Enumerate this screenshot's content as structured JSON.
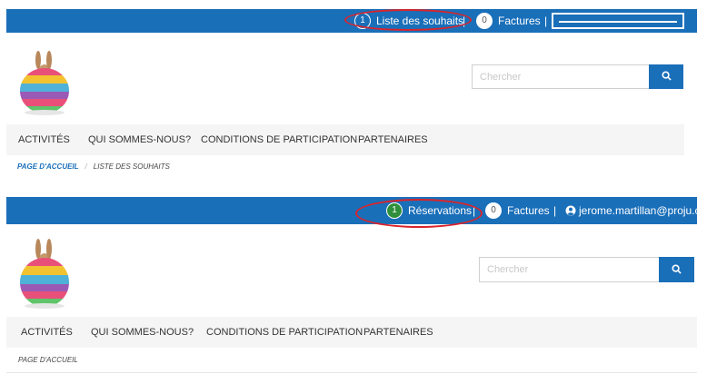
{
  "shot1": {
    "topbar": {
      "wishlist": {
        "count": "1",
        "label": "Liste des souhaits"
      },
      "invoices": {
        "count": "0",
        "label": "Factures"
      },
      "separator": "|"
    },
    "search": {
      "placeholder": "Chercher"
    },
    "nav": [
      "ACTIVITÉS",
      "QUI SOMMES-NOUS?",
      "CONDITIONS DE PARTICIPATION",
      "PARTENAIRES"
    ],
    "breadcrumb": {
      "home": "PAGE D'ACCUEIL",
      "separator": "/",
      "current": "LISTE DES SOUHAITS"
    }
  },
  "shot2": {
    "topbar": {
      "reservations": {
        "count": "1",
        "label": "Réservations"
      },
      "invoices": {
        "count": "0",
        "label": "Factures"
      },
      "separator": "|",
      "user": {
        "email": "jerome.martillan@proju.ch"
      }
    },
    "search": {
      "placeholder": "Chercher"
    },
    "nav": [
      "ACTIVITÉS",
      "QUI SOMMES-NOUS?",
      "CONDITIONS DE PARTICIPATION",
      "PARTENAIRES"
    ],
    "breadcrumb": {
      "home": "PAGE D'ACCUEIL"
    }
  },
  "colors": {
    "brand_blue": "#1a6fb9",
    "highlight_red": "#d9242c",
    "badge_green": "#2f8f3a"
  },
  "icons": [
    "logo-easter-egg-bunny",
    "search-icon",
    "user-icon"
  ]
}
